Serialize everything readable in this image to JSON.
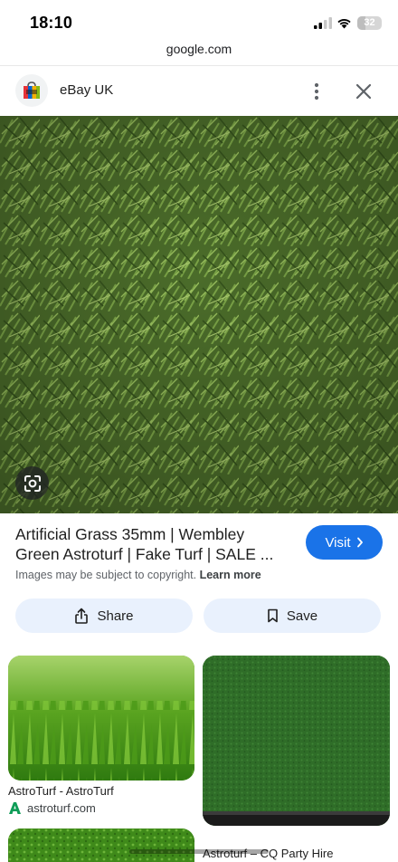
{
  "status": {
    "time": "18:10",
    "battery": "32",
    "battery_level": 0.32
  },
  "browser": {
    "url": "google.com"
  },
  "header": {
    "site_name": "eBay UK"
  },
  "result": {
    "title_line1": "Artificial Grass 35mm | Wembley",
    "title_line2": "Green Astroturf | Fake Turf | SALE ...",
    "visit_label": "Visit",
    "copyright_text": "Images may be subject to copyright.",
    "learn_more_label": "Learn more",
    "share_label": "Share",
    "save_label": "Save"
  },
  "related": [
    {
      "title": "AstroTurf - AstroTurf",
      "source": "astroturf.com"
    },
    {
      "title": "Astroturf – CQ Party Hire",
      "source": ""
    },
    {
      "title": "",
      "source": ""
    }
  ],
  "colors": {
    "accent": "#1a73e8",
    "button_bg": "#e9f1fd",
    "grass": "#4d6e2c"
  }
}
